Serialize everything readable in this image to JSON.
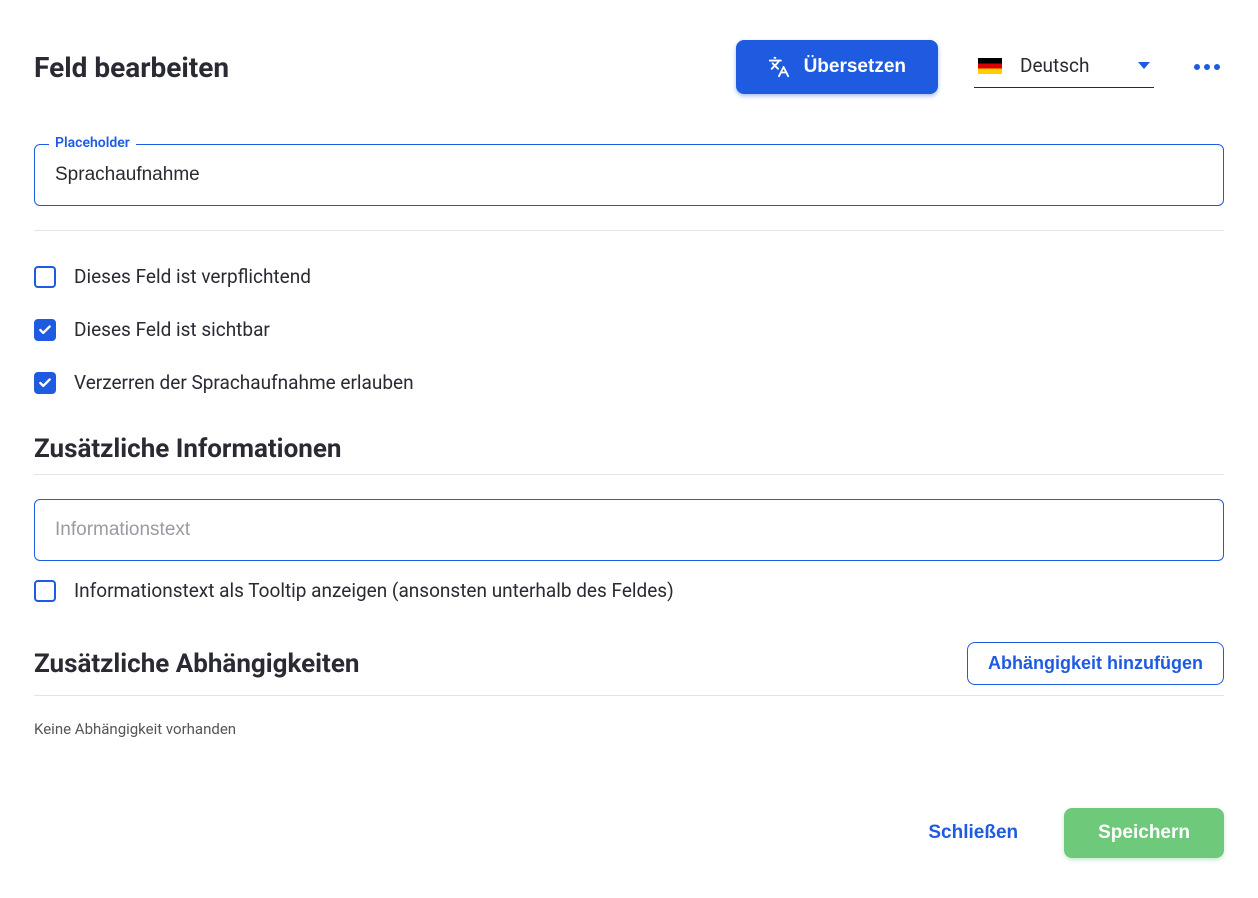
{
  "header": {
    "title": "Feld bearbeiten",
    "translate_label": "Übersetzen",
    "language_label": "Deutsch"
  },
  "placeholder_field": {
    "label": "Placeholder",
    "value": "Sprachaufnahme"
  },
  "checks": {
    "mandatory": {
      "label": "Dieses Feld ist verpflichtend",
      "checked": false
    },
    "visible": {
      "label": "Dieses Feld ist sichtbar",
      "checked": true
    },
    "distort": {
      "label": "Verzerren der Sprachaufnahme erlauben",
      "checked": true
    }
  },
  "additional_info": {
    "title": "Zusätzliche Informationen",
    "info_placeholder": "Informationstext",
    "tooltip_check": {
      "label": "Informationstext als Tooltip anzeigen (ansonsten unterhalb des Feldes)",
      "checked": false
    }
  },
  "dependencies": {
    "title": "Zusätzliche Abhängigkeiten",
    "add_label": "Abhängigkeit hinzufügen",
    "empty_text": "Keine Abhängigkeit vorhanden"
  },
  "footer": {
    "close_label": "Schließen",
    "save_label": "Speichern"
  }
}
